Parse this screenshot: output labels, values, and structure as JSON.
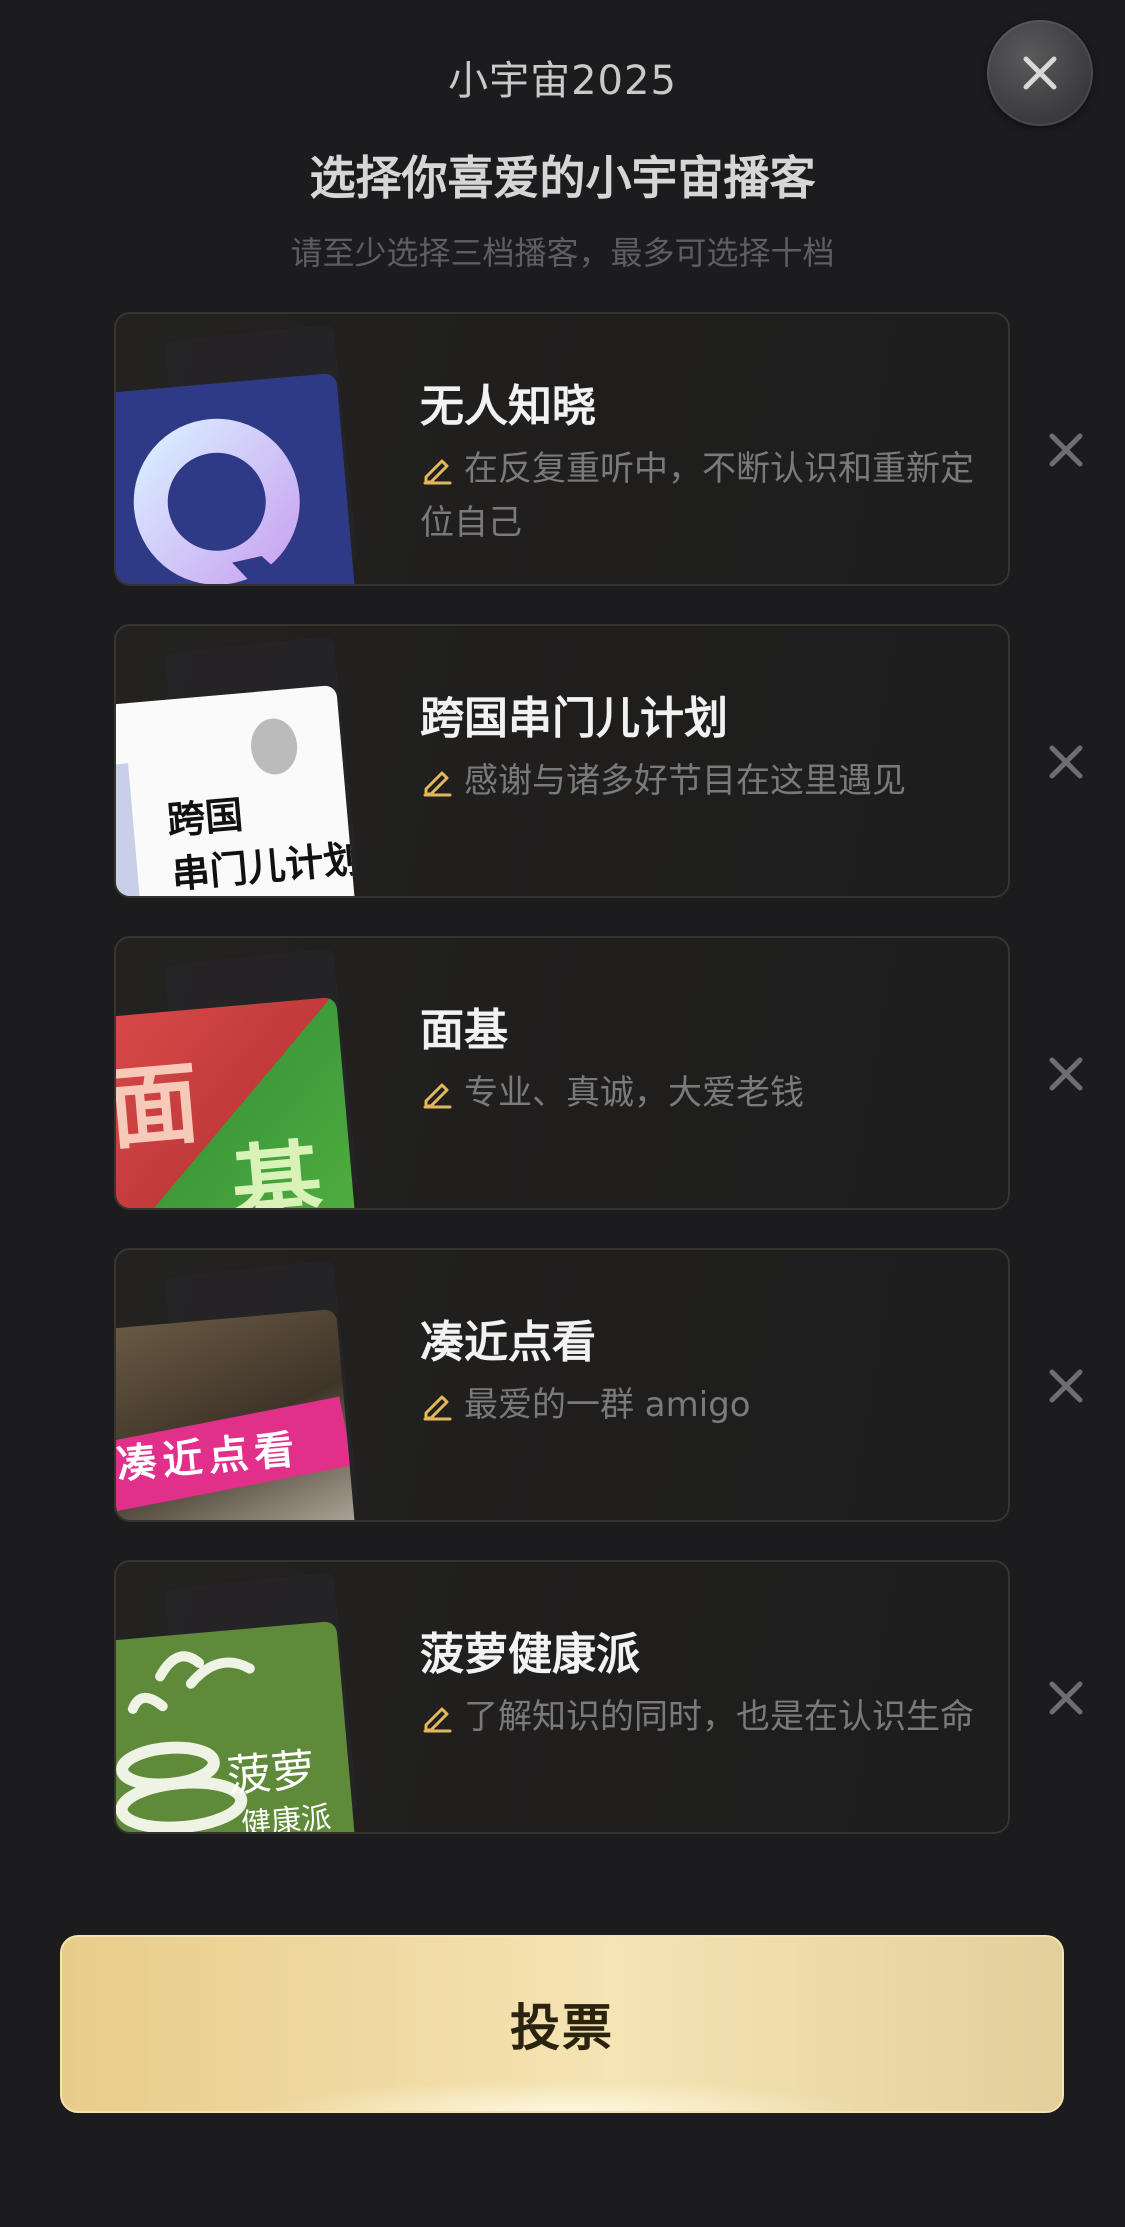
{
  "header": {
    "title": "小宇宙2025"
  },
  "heading": "选择你喜爱的小宇宙播客",
  "subheading": "请至少选择三档播客，最多可选择十档",
  "podcasts": [
    {
      "title": "无人知晓",
      "description": "在反复重听中，不断认识和重新定位自己"
    },
    {
      "title": "跨国串门儿计划",
      "description": "感谢与诸多好节目在这里遇见",
      "cover_text": [
        "跨国",
        "串门儿计划"
      ]
    },
    {
      "title": "面基",
      "description": "专业、真诚，大爱老钱",
      "cover_text": [
        "面",
        "基"
      ]
    },
    {
      "title": "凑近点看",
      "description": "最爱的一群 amigo",
      "cover_text": [
        "凑",
        "近",
        "点",
        "看"
      ]
    },
    {
      "title": "菠萝健康派",
      "description": "了解知识的同时，也是在认识生命",
      "cover_text": [
        "菠萝",
        "健康派"
      ]
    }
  ],
  "vote_button": {
    "label": "投票"
  },
  "colors": {
    "accent_gold": "#e8cc8a",
    "pencil_icon": "#e3b85a",
    "background": "#1c1c1e"
  }
}
